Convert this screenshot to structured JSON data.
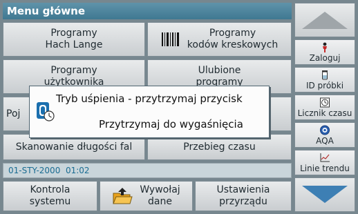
{
  "title": "Menu główne",
  "grid": {
    "hach_lange": [
      "Programy",
      "Hach Lange"
    ],
    "barcode_programs": [
      "Programy",
      "kodów kreskowych"
    ],
    "user_programs": [
      "Programy",
      "użytkownika"
    ],
    "favorites": [
      "Ulubione",
      "programy"
    ],
    "single_wavelength_partial": "Poj",
    "wavelength_scan": "Skanowanie długości fal",
    "time_course": "Przebieg czasu"
  },
  "status": {
    "datetime": "01-STY-2000  01:02"
  },
  "bottom": {
    "system_checks": [
      "Kontrola",
      "systemu"
    ],
    "recall_data": [
      "Wywołaj",
      "dane"
    ],
    "instrument_setup": [
      "Ustawienia",
      "przyrządu"
    ]
  },
  "sidebar": {
    "login": "Zaloguj",
    "sample_id": "ID próbki",
    "timer": "Licznik czasu",
    "aqa": "AQA",
    "trend_lines": "Linie trendu"
  },
  "icons": {
    "up": "arrow-up-icon",
    "down": "arrow-down-icon",
    "login": "person-icon",
    "sample_id": "vial-icon",
    "timer": "timer-icon",
    "aqa": "aqa-icon",
    "trend": "trend-chart-icon",
    "barcode": "barcode-icon",
    "folder": "folder-upload-icon",
    "sleep": "sleep-mode-icon"
  },
  "dialog": {
    "line1": "Tryb uśpienia - przytrzymaj przycisk",
    "line2": "Przytrzymaj do wygaśnięcia"
  },
  "colors": {
    "title_bar": "#4b84a0",
    "status_text": "#1a6c92",
    "arrow_blue": "#3d7fb4"
  }
}
